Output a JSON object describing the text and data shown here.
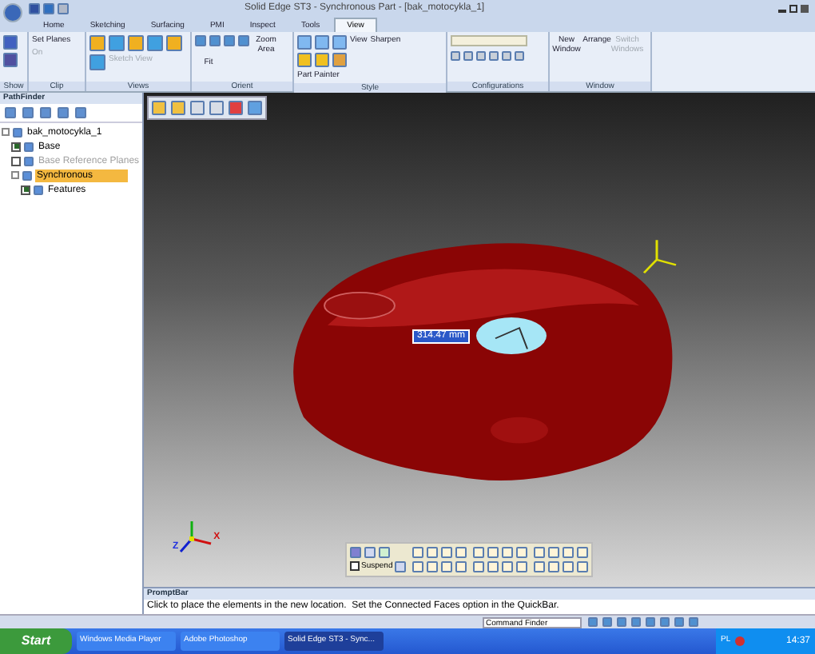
{
  "window": {
    "title": "Solid Edge ST3 - Synchronous Part - [bak_motocykla_1]"
  },
  "tabs": [
    {
      "label": "Home",
      "selected": false
    },
    {
      "label": "Sketching",
      "selected": false
    },
    {
      "label": "Surfacing",
      "selected": false
    },
    {
      "label": "PMI",
      "selected": false
    },
    {
      "label": "Inspect",
      "selected": false
    },
    {
      "label": "Tools",
      "selected": false
    },
    {
      "label": "View",
      "selected": true
    }
  ],
  "ribbon": {
    "groups": [
      {
        "title": "Show"
      },
      {
        "title": "Clip",
        "buttons": [
          {
            "label": "Set Planes",
            "disabled": false
          },
          {
            "label": "On",
            "disabled": true
          }
        ]
      },
      {
        "title": "Views",
        "buttons": [
          {
            "label": "Sketch View",
            "disabled": true
          }
        ]
      },
      {
        "title": "Orient",
        "buttons": [
          {
            "label": "Zoom Area",
            "disabled": false
          },
          {
            "label": "Fit",
            "disabled": false
          }
        ]
      },
      {
        "title": "Style",
        "buttons": [
          {
            "label": "View",
            "disabled": false
          },
          {
            "label": "Sharpen",
            "disabled": false
          },
          {
            "label": "Part Painter",
            "disabled": false
          }
        ]
      },
      {
        "title": "Configurations"
      },
      {
        "title": "Window",
        "buttons": [
          {
            "label": "New Window",
            "disabled": false
          },
          {
            "label": "Arrange",
            "disabled": false
          },
          {
            "label": "Switch Windows",
            "disabled": true
          }
        ]
      }
    ]
  },
  "pathfinder": {
    "title": "PathFinder",
    "tree": [
      {
        "label": "bak_motocykla_1",
        "selected": false,
        "disabled": false,
        "children": [
          {
            "label": "Base",
            "checked": true,
            "selected": false,
            "disabled": false
          },
          {
            "label": "Base Reference Planes",
            "checked": false,
            "selected": false,
            "disabled": true
          },
          {
            "label": "Synchronous",
            "selected": true,
            "disabled": false,
            "children": [
              {
                "label": "Features",
                "checked": true,
                "selected": false,
                "disabled": false
              }
            ]
          }
        ]
      }
    ]
  },
  "viewport": {
    "dimension": "314.47 mm",
    "axis_labels": [
      "X",
      "Z"
    ],
    "quickbar": {
      "suspend": {
        "label": "Suspend",
        "checked": false
      }
    }
  },
  "promptbar": {
    "title": "PromptBar",
    "text": "Click to place the elements in the new location.  Set the Connected Faces option in the QuickBar."
  },
  "status_bar": {
    "command_finder": "Command Finder"
  },
  "taskbar": {
    "start": "Start",
    "items": [
      {
        "label": "Windows Media Player",
        "selected": false
      },
      {
        "label": "Adobe Photoshop",
        "selected": false
      },
      {
        "label": "Solid Edge ST3 - Sync...",
        "selected": true
      }
    ],
    "language": "PL",
    "time": "14:37"
  }
}
